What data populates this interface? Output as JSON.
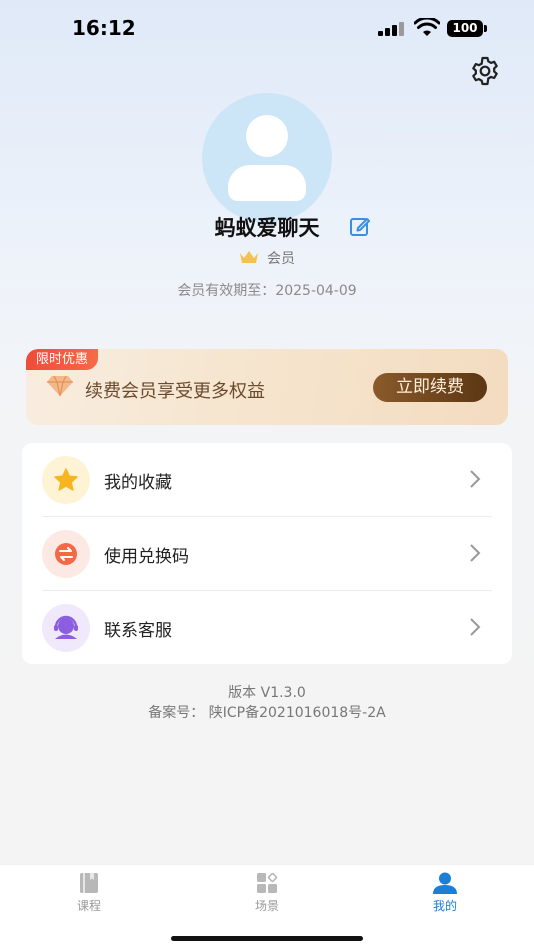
{
  "status_bar": {
    "time": "16:12",
    "battery": "100"
  },
  "profile": {
    "username": "蚂蚁爱聊天",
    "member_label": "会员",
    "expiry_prefix": "会员有效期至：",
    "expiry_date": "2025-04-09"
  },
  "promo": {
    "tag": "限时优惠",
    "text": "续费会员享受更多权益",
    "button": "立即续费"
  },
  "menu": {
    "items": [
      {
        "label": "我的收藏",
        "icon": "star-icon"
      },
      {
        "label": "使用兑换码",
        "icon": "exchange-icon"
      },
      {
        "label": "联系客服",
        "icon": "customer-service-icon"
      }
    ]
  },
  "footer": {
    "version": "版本 V1.3.0",
    "icp": "备案号：  陕ICP备2021016018号-2A"
  },
  "tabbar": {
    "tabs": [
      {
        "label": "课程",
        "icon": "book-icon",
        "active": false
      },
      {
        "label": "场景",
        "icon": "grid-icon",
        "active": false
      },
      {
        "label": "我的",
        "icon": "user-icon",
        "active": true
      }
    ]
  },
  "colors": {
    "accent": "#1b7fd6",
    "promo_tag": "#ef4b3b",
    "promo_button": "#6e4520"
  }
}
